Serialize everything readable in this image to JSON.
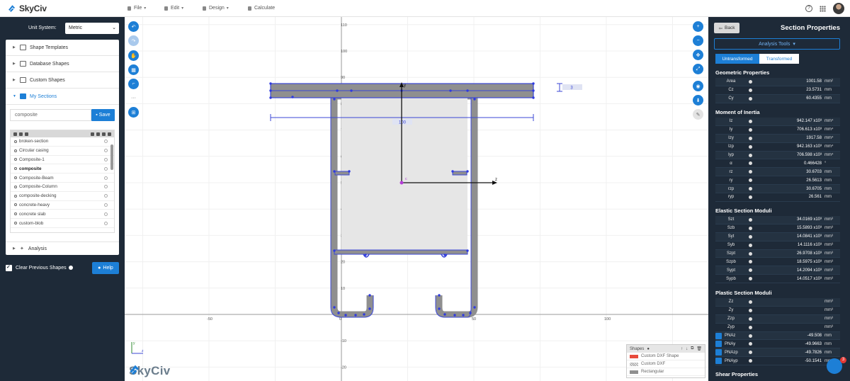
{
  "brand": {
    "name": "SkyCiv",
    "accent": "#1d7fd6",
    "panel_bg": "#1e2a38"
  },
  "menu": [
    {
      "label": "File",
      "icon": "file-icon"
    },
    {
      "label": "Edit",
      "icon": "pencil-icon"
    },
    {
      "label": "Design",
      "icon": "design-icon"
    },
    {
      "label": "Calculate",
      "icon": "calculator-icon"
    }
  ],
  "left": {
    "unit_label": "Unit System:",
    "unit_value": "Metric",
    "accordions": [
      "Shape Templates",
      "Database Shapes",
      "Custom Shapes",
      "My Sections"
    ],
    "search_value": "composite",
    "save_label": "Save",
    "sections": [
      "broken-section",
      "Circular casing",
      "Composite-1",
      "composite",
      "Composite-Beam",
      "Composite-Column",
      "composite-decking",
      "concrete-heavy",
      "concrete slab",
      "custom-blob"
    ],
    "selected_section": "composite",
    "analysis_label": "Analysis",
    "clear_label": "Clear Previous Shapes",
    "help_label": "Help"
  },
  "canvas": {
    "y_ticks": [
      "110",
      "100",
      "90",
      "80",
      "70",
      "60",
      "50",
      "40",
      "30",
      "20",
      "10",
      "0",
      "-10",
      "-20"
    ],
    "x_ticks": [
      "-50",
      "0",
      "50",
      "100"
    ],
    "dim_label": "3",
    "width_label": "100",
    "centroid_label": "c",
    "axis_z": "z",
    "axis_y": "y",
    "watermark": "SkyCiv",
    "shapes_title": "Shapes",
    "shapes": [
      {
        "label": "Custom DXF Shape",
        "color": "#e84b3c"
      },
      {
        "label": "Custom DXF",
        "color": "#bbbbbb"
      },
      {
        "label": "Rectangular",
        "color": "#8f8f8f"
      }
    ]
  },
  "right": {
    "back_label": "Back",
    "title": "Section Properties",
    "tools_label": "Analysis Tools",
    "tab_untransformed": "Untransformed",
    "tab_transformed": "Transformed",
    "geometric_title": "Geometric Properties",
    "geometric": [
      {
        "name": "Area",
        "value": "1001.58",
        "unit": "mm²"
      },
      {
        "name": "Cz",
        "value": "23.5731",
        "unit": "mm"
      },
      {
        "name": "Cy",
        "value": "60.4355",
        "unit": "mm"
      }
    ],
    "inertia_title": "Moment of Inertia",
    "inertia": [
      {
        "name": "Iz",
        "value": "942.147 x10³",
        "unit": "mm⁴"
      },
      {
        "name": "Iy",
        "value": "706.613 x10³",
        "unit": "mm⁴"
      },
      {
        "name": "Izy",
        "value": "1917.58",
        "unit": "mm⁴"
      },
      {
        "name": "Izp",
        "value": "942.163 x10³",
        "unit": "mm⁴"
      },
      {
        "name": "Iyp",
        "value": "706.598 x10³",
        "unit": "mm⁴"
      },
      {
        "name": "α",
        "value": "0.466428",
        "unit": "°"
      },
      {
        "name": "rz",
        "value": "30.6703",
        "unit": "mm"
      },
      {
        "name": "ry",
        "value": "26.5613",
        "unit": "mm"
      },
      {
        "name": "rzp",
        "value": "30.6705",
        "unit": "mm"
      },
      {
        "name": "ryp",
        "value": "26.561",
        "unit": "mm"
      }
    ],
    "elastic_title": "Elastic Section Moduli",
    "elastic": [
      {
        "name": "Szt",
        "value": "34.0169 x10³",
        "unit": "mm³"
      },
      {
        "name": "Szb",
        "value": "15.5893 x10³",
        "unit": "mm³"
      },
      {
        "name": "Syt",
        "value": "14.0841 x10³",
        "unit": "mm³"
      },
      {
        "name": "Syb",
        "value": "14.1116 x10³",
        "unit": "mm³"
      },
      {
        "name": "Szpt",
        "value": "26.9708 x10³",
        "unit": "mm³"
      },
      {
        "name": "Szpb",
        "value": "18.5975 x10³",
        "unit": "mm³"
      },
      {
        "name": "Sypt",
        "value": "14.2094 x10³",
        "unit": "mm³"
      },
      {
        "name": "Sypb",
        "value": "14.0517 x10³",
        "unit": "mm³"
      }
    ],
    "plastic_title": "Plastic Section Moduli",
    "plastic": [
      {
        "name": "Zz",
        "value": "",
        "unit": "mm³"
      },
      {
        "name": "Zy",
        "value": "",
        "unit": "mm³"
      },
      {
        "name": "Zzp",
        "value": "",
        "unit": "mm³"
      },
      {
        "name": "Zyp",
        "value": "",
        "unit": "mm³"
      }
    ],
    "pna": [
      {
        "name": "PNAz",
        "value": "-49.508",
        "unit": "mm"
      },
      {
        "name": "PNAy",
        "value": "-49.9663",
        "unit": "mm"
      },
      {
        "name": "PNAzp",
        "value": "-49.7826",
        "unit": "mm"
      },
      {
        "name": "PNAyp",
        "value": "-50.1541",
        "unit": "mm"
      }
    ],
    "shear_title": "Shear Properties"
  },
  "chat_badge": "3"
}
